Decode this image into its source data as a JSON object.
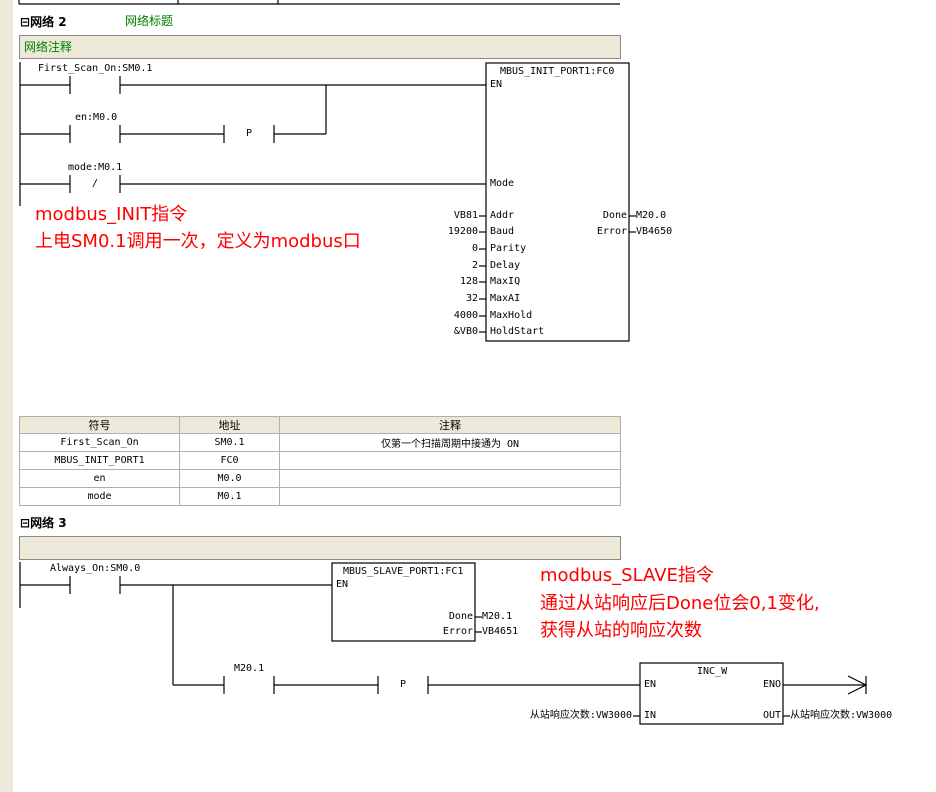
{
  "networks": [
    {
      "id": "network-2",
      "title": "网络 2",
      "subtitle": "网络标题",
      "comment": "网络注释"
    },
    {
      "id": "network-3",
      "title": "网络 3",
      "subtitle": "",
      "comment": ""
    }
  ],
  "net2": {
    "contacts": [
      {
        "label": "First_Scan_On:SM0.1",
        "type": "NO"
      },
      {
        "label": "en:M0.0",
        "type": "NO"
      },
      {
        "label": "P",
        "type": "P"
      },
      {
        "label": "mode:M0.1",
        "type": "NC",
        "symbol": "/"
      }
    ],
    "block": {
      "title": "MBUS_INIT_PORT1:FC0",
      "en": "EN",
      "inputs": [
        {
          "pin": "Mode",
          "value": ""
        },
        {
          "pin": "Addr",
          "value": "VB81"
        },
        {
          "pin": "Baud",
          "value": "19200"
        },
        {
          "pin": "Parity",
          "value": "0"
        },
        {
          "pin": "Delay",
          "value": "2"
        },
        {
          "pin": "MaxIQ",
          "value": "128"
        },
        {
          "pin": "MaxAI",
          "value": "32"
        },
        {
          "pin": "MaxHold",
          "value": "4000"
        },
        {
          "pin": "HoldStart",
          "value": "&VB0"
        }
      ],
      "outputs": [
        {
          "pin": "Done",
          "value": "M20.0"
        },
        {
          "pin": "Error",
          "value": "VB4650"
        }
      ]
    },
    "annotation": [
      "modbus_INIT指令",
      "上电SM0.1调用一次，定义为modbus口"
    ]
  },
  "symbol_table": {
    "headers": [
      "符号",
      "地址",
      "注释"
    ],
    "rows": [
      [
        "First_Scan_On",
        "SM0.1",
        "仅第一个扫描周期中接通为 ON"
      ],
      [
        "MBUS_INIT_PORT1",
        "FC0",
        ""
      ],
      [
        "en",
        "M0.0",
        ""
      ],
      [
        "mode",
        "M0.1",
        ""
      ]
    ]
  },
  "net3": {
    "contacts": [
      {
        "label": "Always_On:SM0.0",
        "type": "NO"
      },
      {
        "label": "M20.1",
        "type": "NO"
      },
      {
        "label": "P",
        "type": "P"
      }
    ],
    "slave_block": {
      "title": "MBUS_SLAVE_PORT1:FC1",
      "en": "EN",
      "outputs": [
        {
          "pin": "Done",
          "value": "M20.1"
        },
        {
          "pin": "Error",
          "value": "VB4651"
        }
      ]
    },
    "inc_block": {
      "title": "INC_W",
      "en": "EN",
      "eno": "ENO",
      "in_pin": "IN",
      "out_pin": "OUT",
      "in_value": "从站响应次数:VW3000",
      "out_value": "从站响应次数:VW3000"
    },
    "annotation": [
      "modbus_SLAVE指令",
      "通过从站响应后Done位会0,1变化,",
      "获得从站的响应次数"
    ]
  }
}
